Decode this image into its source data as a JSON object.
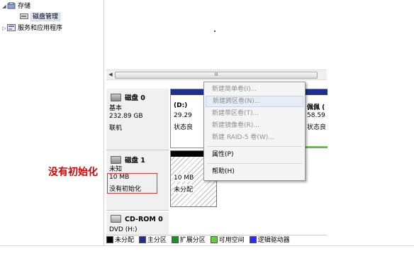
{
  "tree": {
    "storage": "存储",
    "disk_management": "磁盘管理",
    "services_apps": "服务和应用程序"
  },
  "scrollbar": {
    "grip": "III"
  },
  "disk0": {
    "title": "磁盘 0",
    "type": "基本",
    "size": "232.89 GB",
    "status": "联机",
    "vol_d_name": "(D:)",
    "vol_d_size": "29.29",
    "vol_d_status": "状态良",
    "vol_right_name": "佩佩 (",
    "vol_right_size": "58.59",
    "vol_right_status": "状态良"
  },
  "disk1": {
    "title": "磁盘 1",
    "type": "未知",
    "size": "10 MB",
    "status": "没有初始化",
    "unalloc_size": "10 MB",
    "unalloc_label": "未分配"
  },
  "annotation": "没有初始化",
  "cdrom": {
    "title": "CD-ROM 0",
    "line": "DVD (H:)"
  },
  "menu": {
    "items": [
      "新建简单卷(I)...",
      "新建跨区卷(N)...",
      "新建带区卷(T)...",
      "新建镜像卷(R)...",
      "新建 RAID-5 卷(W)...",
      "属性(P)",
      "帮助(H)"
    ]
  },
  "legend": {
    "items": [
      "未分配",
      "主分区",
      "扩展分区",
      "可用空间",
      "逻辑驱动器"
    ],
    "colors": [
      "#000000",
      "#1f2f8f",
      "#1f8f1f",
      "#66cc33",
      "#2a2aff"
    ]
  },
  "colors": {
    "primary_bar": "#1f2f8f",
    "unalloc_bar": "#000000",
    "annotation_red": "#e00000"
  }
}
